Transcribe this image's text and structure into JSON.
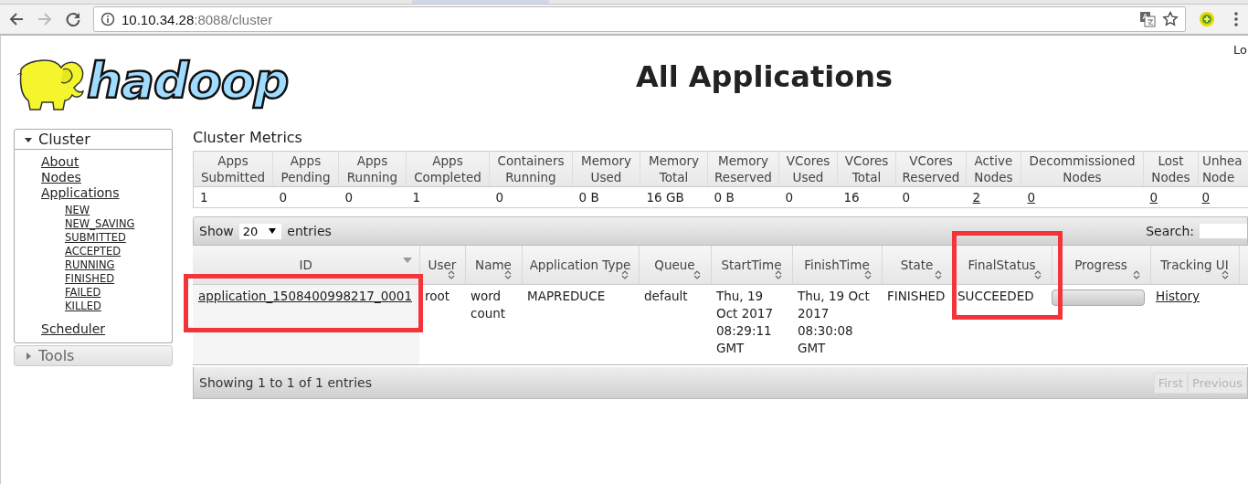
{
  "browser": {
    "back_disabled": false,
    "forward_disabled": true,
    "url_host": "10.10.34.28",
    "url_rest": ":8088/cluster"
  },
  "logo": {
    "text": "hadoop"
  },
  "title": "All Applications",
  "login": "Lo",
  "sidebar": {
    "sections": [
      {
        "label": "Cluster",
        "expanded": true,
        "items": [
          {
            "label": "About"
          },
          {
            "label": "Nodes"
          },
          {
            "label": "Applications",
            "children": [
              {
                "label": "NEW"
              },
              {
                "label": "NEW_SAVING"
              },
              {
                "label": "SUBMITTED"
              },
              {
                "label": "ACCEPTED"
              },
              {
                "label": "RUNNING"
              },
              {
                "label": "FINISHED"
              },
              {
                "label": "FAILED"
              },
              {
                "label": "KILLED"
              }
            ]
          },
          {
            "label": "Scheduler"
          }
        ]
      },
      {
        "label": "Tools",
        "expanded": false
      }
    ]
  },
  "metrics": {
    "title": "Cluster Metrics",
    "columns": [
      "Apps Submitted",
      "Apps Pending",
      "Apps Running",
      "Apps Completed",
      "Containers Running",
      "Memory Used",
      "Memory Total",
      "Memory Reserved",
      "VCores Used",
      "VCores Total",
      "VCores Reserved",
      "Active Nodes",
      "Decommissioned Nodes",
      "Lost Nodes",
      "Unhea Node"
    ],
    "values": [
      {
        "text": "1",
        "link": false
      },
      {
        "text": "0",
        "link": false
      },
      {
        "text": "0",
        "link": false
      },
      {
        "text": "1",
        "link": false
      },
      {
        "text": "0",
        "link": false
      },
      {
        "text": "0 B",
        "link": false
      },
      {
        "text": "16 GB",
        "link": false
      },
      {
        "text": "0 B",
        "link": false
      },
      {
        "text": "0",
        "link": false
      },
      {
        "text": "16",
        "link": false
      },
      {
        "text": "0",
        "link": false
      },
      {
        "text": "2",
        "link": true
      },
      {
        "text": "0",
        "link": true
      },
      {
        "text": "0",
        "link": true
      },
      {
        "text": "0",
        "link": true
      }
    ]
  },
  "applications": {
    "length_menu": {
      "before": "Show",
      "value": "20",
      "after": "entries"
    },
    "search": {
      "label": "Search:"
    },
    "columns": [
      {
        "label": "ID",
        "sorted": true,
        "highlighted": true
      },
      {
        "label": "User",
        "sorted": false,
        "highlighted": false
      },
      {
        "label": "Name",
        "sorted": false,
        "highlighted": false
      },
      {
        "label": "Application Type",
        "sorted": false,
        "highlighted": false
      },
      {
        "label": "Queue",
        "sorted": false,
        "highlighted": false
      },
      {
        "label": "StartTime",
        "sorted": false,
        "highlighted": false
      },
      {
        "label": "FinishTime",
        "sorted": false,
        "highlighted": false
      },
      {
        "label": "State",
        "sorted": false,
        "highlighted": false
      },
      {
        "label": "FinalStatus",
        "sorted": false,
        "highlighted": true
      },
      {
        "label": "Progress",
        "sorted": false,
        "highlighted": false
      },
      {
        "label": "Tracking UI",
        "sorted": false,
        "highlighted": false
      }
    ],
    "rows": [
      {
        "cells": [
          {
            "kind": "link",
            "text": "application_1508400998217_0001"
          },
          {
            "kind": "text",
            "text": "root"
          },
          {
            "kind": "text",
            "text": "word count"
          },
          {
            "kind": "text",
            "text": "MAPREDUCE"
          },
          {
            "kind": "text",
            "text": "default"
          },
          {
            "kind": "text",
            "text": "Thu, 19 Oct 2017 08:29:11 GMT"
          },
          {
            "kind": "text",
            "text": "Thu, 19 Oct 2017 08:30:08 GMT"
          },
          {
            "kind": "text",
            "text": "FINISHED"
          },
          {
            "kind": "text",
            "text": "SUCCEEDED"
          },
          {
            "kind": "progress",
            "level": 1
          },
          {
            "kind": "link",
            "text": "History"
          }
        ]
      }
    ],
    "info": "Showing 1 to 1 of 1 entries",
    "pager": [
      {
        "label": "First",
        "disabled": true
      },
      {
        "label": "Previous",
        "disabled": true
      }
    ]
  }
}
